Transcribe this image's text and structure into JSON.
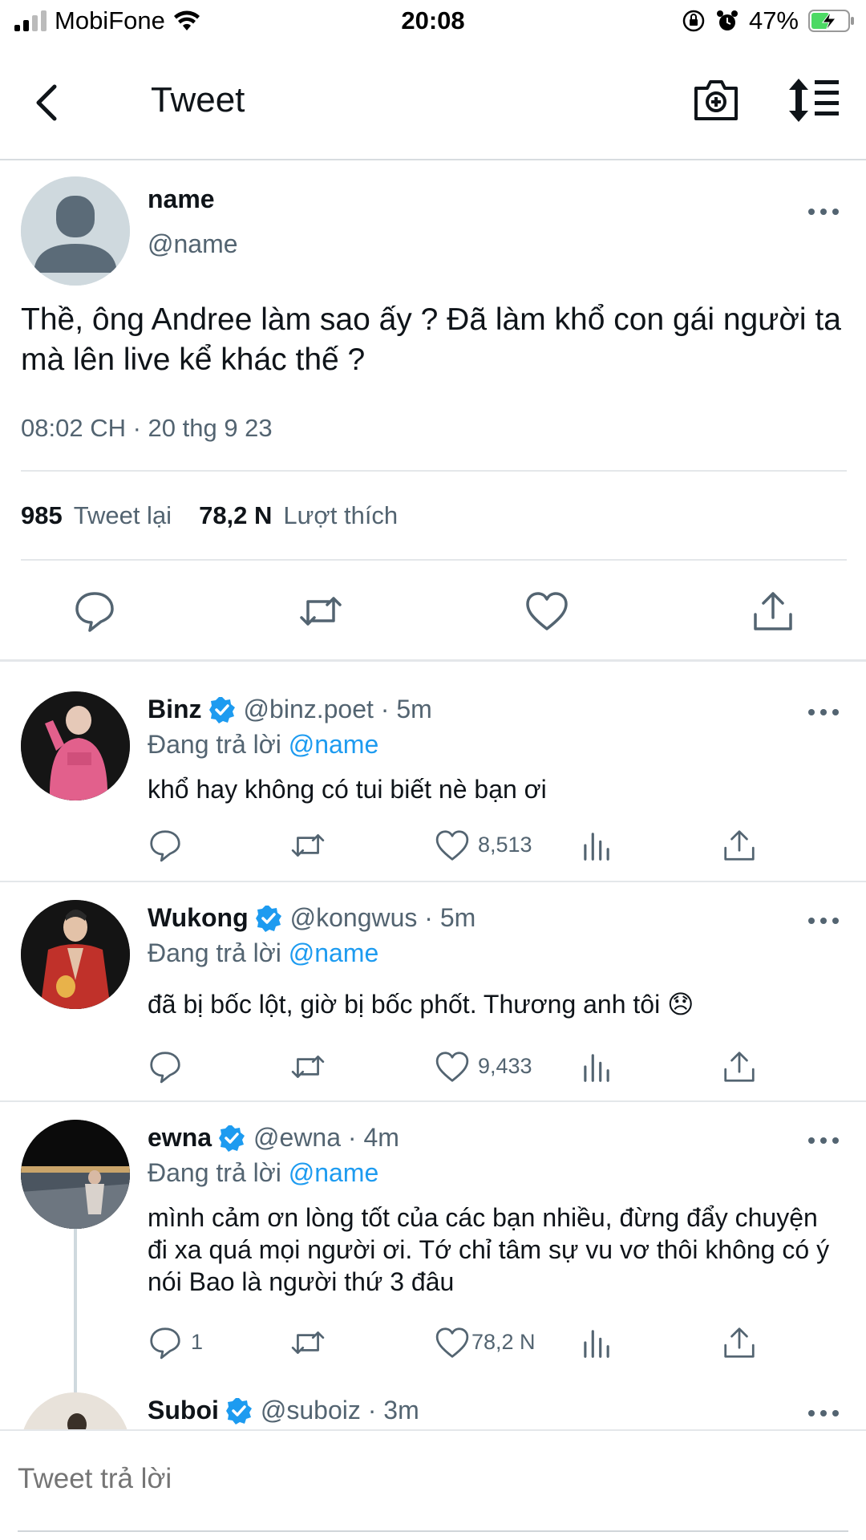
{
  "status_bar": {
    "carrier": "MobiFone",
    "time": "20:08",
    "battery": "47%"
  },
  "header": {
    "title": "Tweet",
    "back_icon": "chevron-left-icon",
    "camera_icon": "camera-plus-icon",
    "sort_icon": "sort-list-icon"
  },
  "main_tweet": {
    "name": "name",
    "handle": "@name",
    "text": "Thề, ông Andree làm sao ấy ? Đã làm khổ con gái người ta mà lên live kể khác thế ?",
    "timestamp": "08:02 CH · 20 thg 9 23",
    "retweets_count": "985",
    "retweets_label": "Tweet lại",
    "likes_count": "78,2 N",
    "likes_label": "Lượt thích"
  },
  "replies": [
    {
      "name": "Binz",
      "verified": true,
      "handle": "@binz.poet · 5m",
      "replying_prefix": "Đang trả lời",
      "replying_to": "@name",
      "text": "khổ hay không có tui biết nè bạn ơi",
      "reply_count": "",
      "like_count": "8,513"
    },
    {
      "name": "Wukong",
      "verified": true,
      "handle": "@kongwus · 5m",
      "replying_prefix": "Đang trả lời",
      "replying_to": "@name",
      "text": "đã bị bốc lột, giờ bị bốc phốt. Thương anh tôi 😞",
      "reply_count": "",
      "like_count": "9,433"
    },
    {
      "name": "ewna",
      "verified": true,
      "handle": "@ewna · 4m",
      "replying_prefix": "Đang trả lời",
      "replying_to": "@name",
      "text": "mình cảm ơn lòng tốt của các bạn nhiều, đừng đẩy chuyện đi xa quá mọi người ơi. Tớ chỉ tâm sự vu vơ thôi không có ý nói Bao là người thứ 3 đâu",
      "reply_count": "1",
      "like_count": "78,2 N"
    },
    {
      "name": "Suboi",
      "verified": true,
      "handle": "@suboiz · 3m"
    }
  ],
  "reply_bar": {
    "placeholder": "Tweet trả lời"
  },
  "colors": {
    "accent": "#1d9bf0",
    "text": "#0f1419",
    "secondary": "#536471",
    "divider": "#e4e7ea"
  }
}
